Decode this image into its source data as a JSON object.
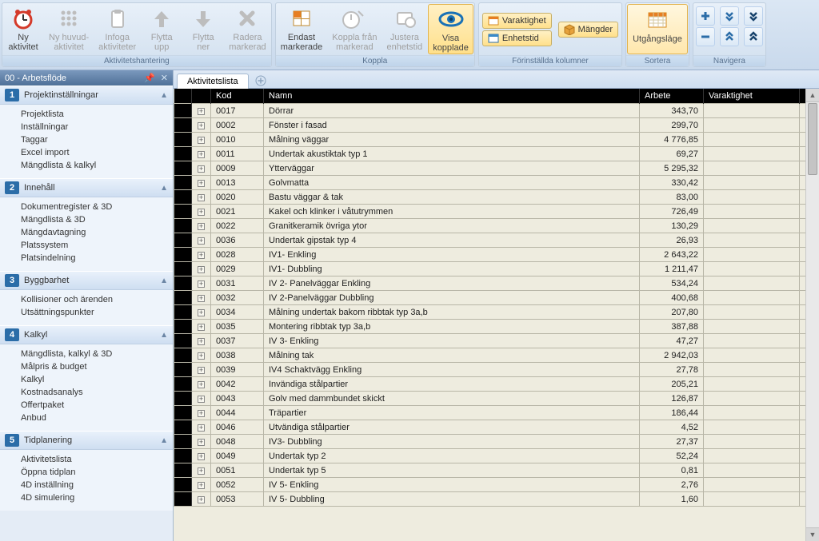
{
  "ribbon": {
    "groups": [
      {
        "title": "Aktivitetshantering",
        "buttons": [
          {
            "label": "Ny\naktivitet",
            "icon": "clock-red",
            "enabled": true
          },
          {
            "label": "Ny huvud-\naktivitet",
            "icon": "grid-dots",
            "enabled": false
          },
          {
            "label": "Infoga\naktiviteter",
            "icon": "clipboard",
            "enabled": false
          },
          {
            "label": "Flytta\nupp",
            "icon": "arrow-up",
            "enabled": false
          },
          {
            "label": "Flytta\nner",
            "icon": "arrow-down",
            "enabled": false
          },
          {
            "label": "Radera\nmarkerad",
            "icon": "delete-x",
            "enabled": false
          }
        ]
      },
      {
        "title": "Koppla",
        "buttons": [
          {
            "label": "Endast\nmarkerade",
            "icon": "select-subset",
            "enabled": true
          },
          {
            "label": "Koppla från\nmarkerad",
            "icon": "unlink",
            "enabled": false
          },
          {
            "label": "Justera\nenhetstid",
            "icon": "adjust-time",
            "enabled": false
          },
          {
            "label": "Visa\nkopplade",
            "icon": "eye",
            "enabled": true,
            "active": true
          }
        ]
      },
      {
        "title": "Förinställda kolumner",
        "smallButtons": [
          {
            "label": "Varaktighet",
            "icon": "duration-orange"
          },
          {
            "label": "Enhetstid",
            "icon": "unit-blue"
          },
          {
            "label": "Mängder",
            "icon": "box-orange"
          }
        ]
      },
      {
        "title": "Sortera",
        "buttons": [
          {
            "label": "Utgångsläge",
            "icon": "grid-orange",
            "enabled": true,
            "activeBorder": true
          }
        ]
      },
      {
        "title": "Navigera",
        "nav": [
          [
            "plus-blue",
            "chev-dd-blue",
            "chev-dd-dark"
          ],
          [
            "minus-blue",
            "chev-uu-blue",
            "chev-uu-dark"
          ]
        ]
      }
    ]
  },
  "sidebar": {
    "title": "00 - Arbetsflöde",
    "sections": [
      {
        "num": "1",
        "title": "Projektinställningar",
        "items": [
          "Projektlista",
          "Inställningar",
          "Taggar",
          "Excel import",
          "Mängdlista & kalkyl"
        ]
      },
      {
        "num": "2",
        "title": "Innehåll",
        "items": [
          "Dokumentregister & 3D",
          "Mängdlista & 3D",
          "Mängdavtagning",
          "Platssystem",
          "Platsindelning"
        ]
      },
      {
        "num": "3",
        "title": "Byggbarhet",
        "items": [
          "Kollisioner och ärenden",
          "Utsättningspunkter"
        ]
      },
      {
        "num": "4",
        "title": "Kalkyl",
        "items": [
          "Mängdlista, kalkyl & 3D",
          "Målpris & budget",
          "Kalkyl",
          "Kostnadsanalys",
          "Offertpaket",
          "Anbud"
        ]
      },
      {
        "num": "5",
        "title": "Tidplanering",
        "items": [
          "Aktivitetslista",
          "Öppna tidplan",
          "4D inställning",
          "4D simulering"
        ]
      }
    ]
  },
  "tabs": {
    "active": "Aktivitetslista"
  },
  "grid": {
    "headers": {
      "kod": "Kod",
      "namn": "Namn",
      "arbete": "Arbete",
      "varaktighet": "Varaktighet"
    },
    "rows": [
      {
        "kod": "0017",
        "namn": "Dörrar",
        "arbete": "343,70"
      },
      {
        "kod": "0002",
        "namn": "Fönster i fasad",
        "arbete": "299,70"
      },
      {
        "kod": "0010",
        "namn": "Målning väggar",
        "arbete": "4 776,85"
      },
      {
        "kod": "0011",
        "namn": "Undertak akustiktak typ 1",
        "arbete": "69,27"
      },
      {
        "kod": "0009",
        "namn": "Ytterväggar",
        "arbete": "5 295,32"
      },
      {
        "kod": "0013",
        "namn": "Golvmatta",
        "arbete": "330,42"
      },
      {
        "kod": "0020",
        "namn": "Bastu väggar & tak",
        "arbete": "83,00"
      },
      {
        "kod": "0021",
        "namn": "Kakel och klinker i våtutrymmen",
        "arbete": "726,49"
      },
      {
        "kod": "0022",
        "namn": "Granitkeramik övriga ytor",
        "arbete": "130,29"
      },
      {
        "kod": "0036",
        "namn": "Undertak gipstak typ 4",
        "arbete": "26,93"
      },
      {
        "kod": "0028",
        "namn": "IV1- Enkling",
        "arbete": "2 643,22"
      },
      {
        "kod": "0029",
        "namn": "IV1- Dubbling",
        "arbete": "1 211,47"
      },
      {
        "kod": "0031",
        "namn": "IV 2- Panelväggar Enkling",
        "arbete": "534,24"
      },
      {
        "kod": "0032",
        "namn": "IV 2-Panelväggar Dubbling",
        "arbete": "400,68"
      },
      {
        "kod": "0034",
        "namn": "Målning undertak bakom ribbtak typ 3a,b",
        "arbete": "207,80"
      },
      {
        "kod": "0035",
        "namn": "Montering ribbtak typ 3a,b",
        "arbete": "387,88"
      },
      {
        "kod": "0037",
        "namn": "IV 3- Enkling",
        "arbete": "47,27"
      },
      {
        "kod": "0038",
        "namn": "Målning tak",
        "arbete": "2 942,03"
      },
      {
        "kod": "0039",
        "namn": "IV4 Schaktvägg Enkling",
        "arbete": "27,78"
      },
      {
        "kod": "0042",
        "namn": "Invändiga stålpartier",
        "arbete": "205,21"
      },
      {
        "kod": "0043",
        "namn": "Golv med dammbundet skickt",
        "arbete": "126,87"
      },
      {
        "kod": "0044",
        "namn": "Träpartier",
        "arbete": "186,44"
      },
      {
        "kod": "0046",
        "namn": "Utvändiga stålpartier",
        "arbete": "4,52"
      },
      {
        "kod": "0048",
        "namn": "IV3- Dubbling",
        "arbete": "27,37"
      },
      {
        "kod": "0049",
        "namn": "Undertak typ 2",
        "arbete": "52,24"
      },
      {
        "kod": "0051",
        "namn": "Undertak typ 5",
        "arbete": "0,81"
      },
      {
        "kod": "0052",
        "namn": "IV 5- Enkling",
        "arbete": "2,76"
      },
      {
        "kod": "0053",
        "namn": "IV 5- Dubbling",
        "arbete": "1,60"
      }
    ]
  }
}
